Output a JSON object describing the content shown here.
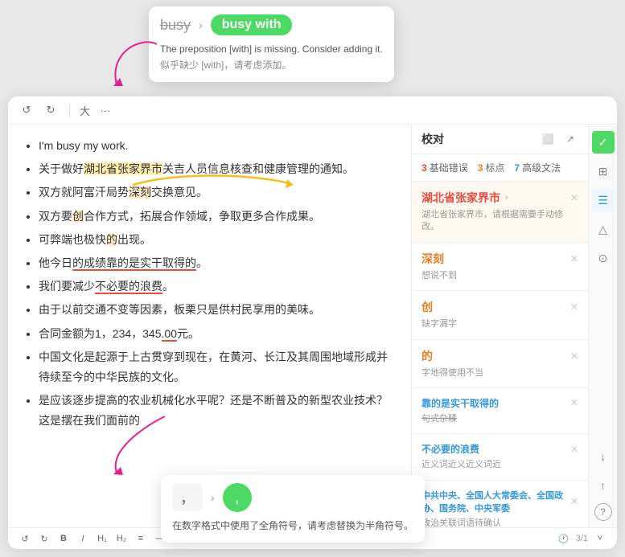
{
  "tooltip_top": {
    "word_old": "busy",
    "word_new": "busy with",
    "desc_en": "The preposition [with] is missing. Consider adding it.",
    "desc_zh": "似乎缺少 [with]，请考虑添加。"
  },
  "toolbar": {
    "undo_label": "↺",
    "redo_label": "↻",
    "font_size": "大",
    "more_label": "···"
  },
  "editor": {
    "items": [
      {
        "text": "I'm busy my work."
      },
      {
        "text": "关于做好湖北省张家界市关吉人员信息核查和健康管理的通知。"
      },
      {
        "text": "双方就阿富汗局势深刻交换意见。"
      },
      {
        "text": "双方要创合作方式，拓展合作领域，争取更多合作成果。"
      },
      {
        "text": "可弊端也极快的出现。"
      },
      {
        "text": "他今日的成绩靠的是实干取得的。"
      },
      {
        "text": "我们要减少不必要的浪费。"
      },
      {
        "text": "由于以前交通不变等因素，板栗只是供村民享用的美味。"
      },
      {
        "text": "合同金额为1，234，345.00元。"
      },
      {
        "text": "中国文化是起源于上古贯穿到现在，在黄河、长江及其周围地域形成并待续至今的中华民族的文化。"
      },
      {
        "text": "是应该逐步提高的农业机械化水平呢？还是不断普及的新型农业技术？这是摆在我们面前的"
      }
    ]
  },
  "right_panel": {
    "title": "校对",
    "stats": {
      "errors": "3",
      "errors_label": "基础错误",
      "dots": "3",
      "dots_label": "标点",
      "advanced": "7",
      "advanced_label": "高级文法"
    },
    "corrections": [
      {
        "word": "湖北省张家界市",
        "arrow": "›",
        "fix": "",
        "desc": "湖北省张家界市，请根据需要手动修改。",
        "type": "red",
        "active": true
      },
      {
        "word": "深刻",
        "sub": "想说不到",
        "arrow": "",
        "fix": "",
        "desc": "",
        "type": "orange"
      },
      {
        "word": "创",
        "sub": "缺字漏字",
        "arrow": "",
        "fix": "",
        "desc": "",
        "type": "orange"
      },
      {
        "word": "的",
        "sub": "字地得使用不当",
        "arrow": "",
        "fix": "",
        "desc": "",
        "type": "orange"
      },
      {
        "word": "靠的是实干取得的",
        "sub": "句式杂糅",
        "arrow": "",
        "fix": "",
        "desc": "",
        "type": "blue"
      },
      {
        "word": "不必要的浪费",
        "sub": "近义词近义近义词近",
        "arrow": "",
        "fix": "",
        "desc": "",
        "type": "blue"
      },
      {
        "word": "中共中央、全国人大常委会、全国政协、国务院、中央军委",
        "sub": "政治关联词语待确认",
        "arrow": "",
        "fix": "",
        "desc": "",
        "type": "blue"
      }
    ]
  },
  "bottom_toolbar": {
    "bold": "B",
    "italic": "I",
    "h1": "H₁",
    "h2": "H₂",
    "list": "≡",
    "quote": "«",
    "page_count": "3/1",
    "more": "˅"
  },
  "tooltip_bottom": {
    "char_old": "，",
    "char_new": ",",
    "desc": "在数字格式中使用了全角符号，请考虑替换为半角符号。"
  }
}
